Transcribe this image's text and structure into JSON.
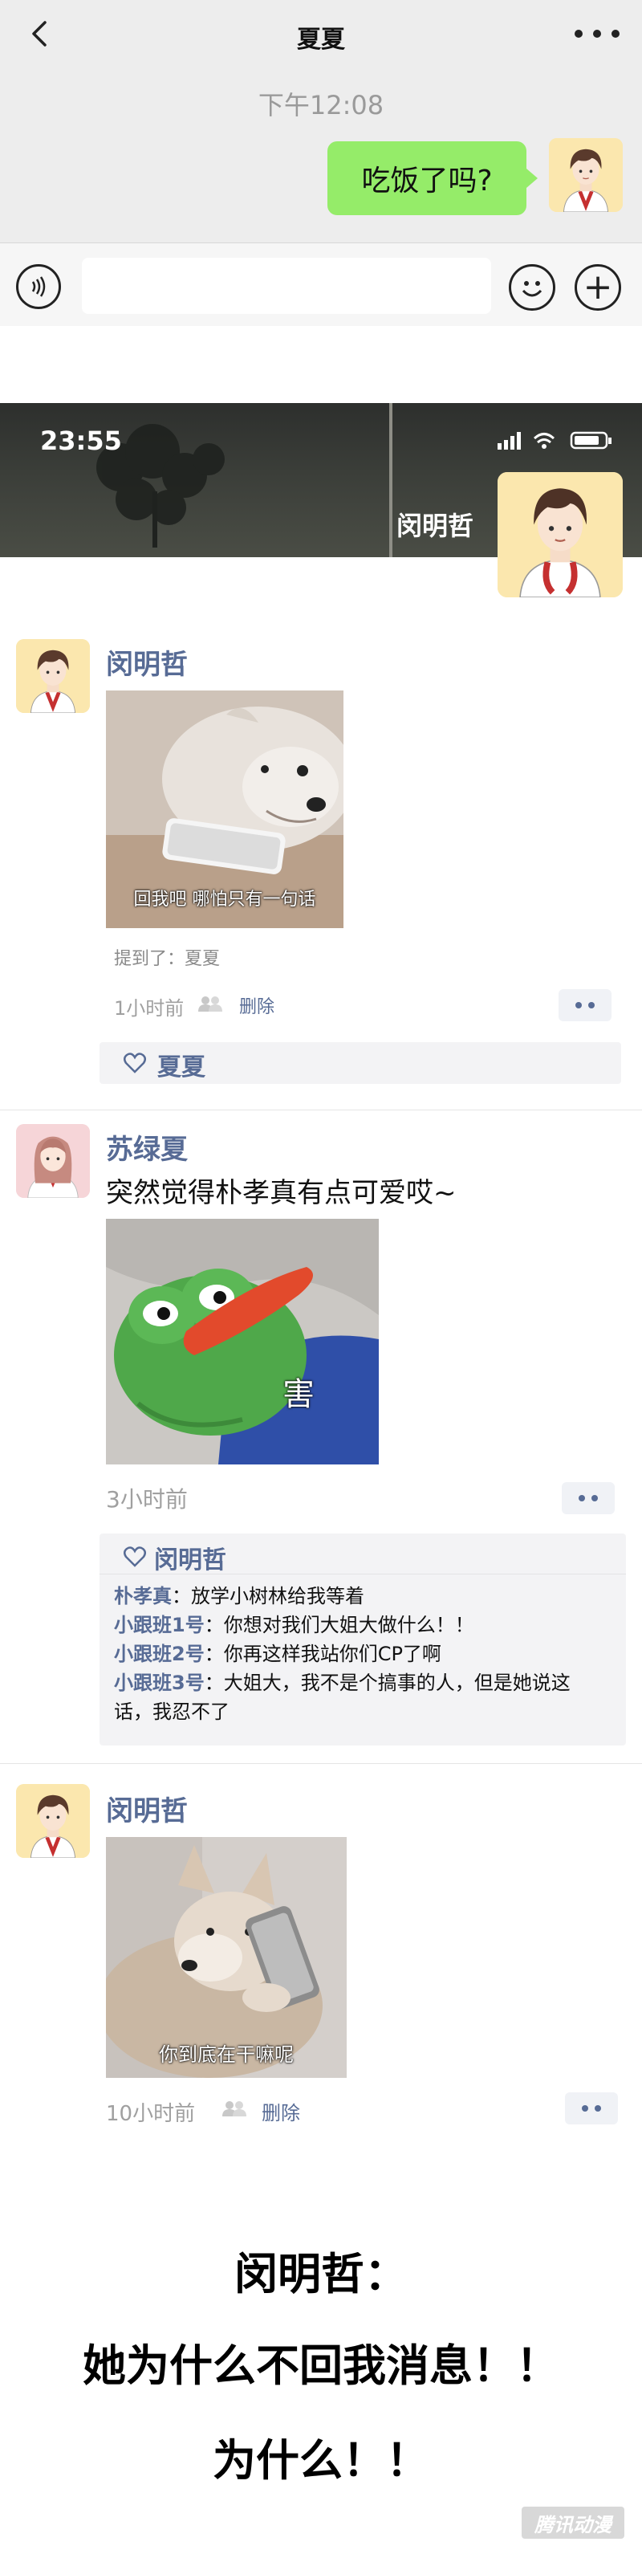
{
  "chat": {
    "title": "夏夏",
    "time": "下午12:08",
    "message": "吃饭了吗?"
  },
  "moments": {
    "status_time": "23:55",
    "owner_name": "闵明哲"
  },
  "posts": [
    {
      "author": "闵明哲",
      "image_caption": "回我吧 哪怕只有一句话",
      "mention": "提到了：夏夏",
      "time": "1小时前",
      "delete_label": "删除",
      "likes": "夏夏"
    },
    {
      "author": "苏绿夏",
      "text": "突然觉得朴孝真有点可爱哎~",
      "image_caption": "害",
      "time": "3小时前",
      "likes": "闵明哲",
      "comments": [
        {
          "name": "朴孝真",
          "text": "：放学小树林给我等着"
        },
        {
          "name": "小跟班1号",
          "text": "：你想对我们大姐大做什么！！"
        },
        {
          "name": "小跟班2号",
          "text": "：你再这样我站你们CP了啊"
        },
        {
          "name": "小跟班3号",
          "text": "：大姐大，我不是个搞事的人，但是她说这"
        },
        {
          "name": "",
          "text": "话，我忍不了"
        }
      ]
    },
    {
      "author": "闵明哲",
      "image_caption": "你到底在干嘛呢",
      "time": "10小时前",
      "delete_label": "删除"
    }
  ],
  "narration": [
    "闵明哲：",
    "她为什么不回我消息！！",
    "为什么！！"
  ],
  "watermark": "腾讯动漫",
  "colors": {
    "bubble": "#95ec69",
    "link": "#576b95",
    "chat_bg": "#ededed"
  },
  "icons": [
    "back-arrow-icon",
    "more-dots-icon",
    "voice-icon",
    "emoji-icon",
    "add-icon",
    "signal-icon",
    "wifi-icon",
    "battery-icon",
    "people-icon",
    "heart-icon"
  ]
}
